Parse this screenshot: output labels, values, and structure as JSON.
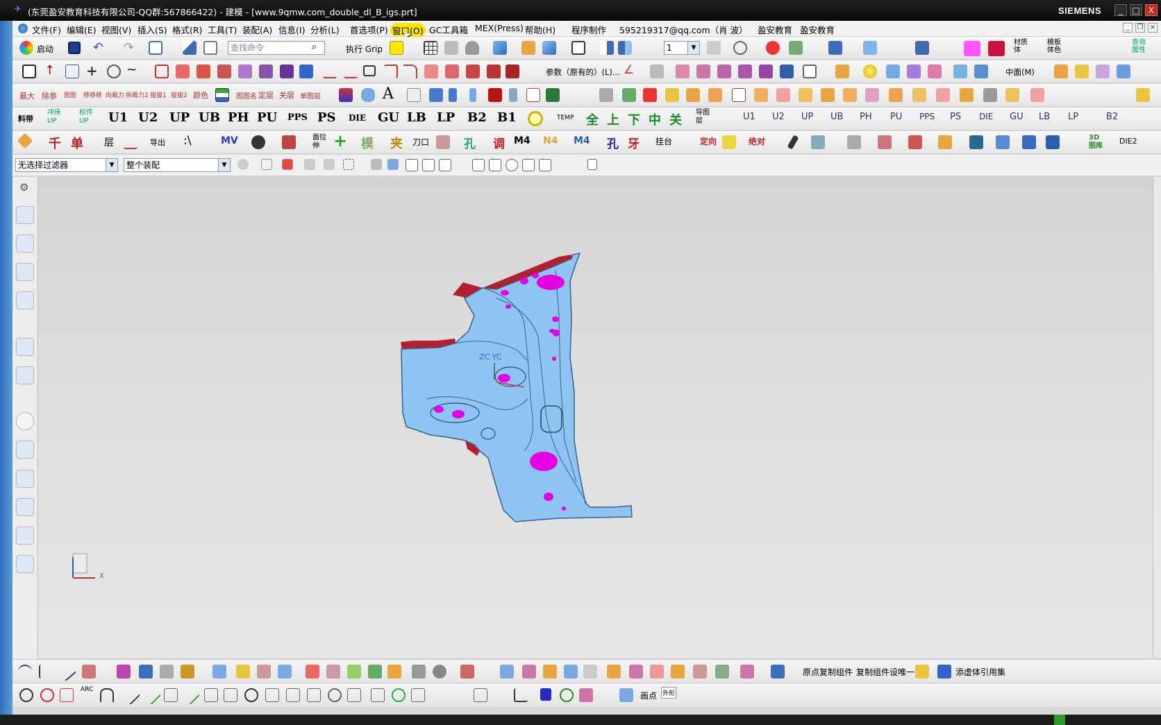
{
  "window": {
    "title": "(东莞盈安教育科技有限公司-QQ群:567866422) - 建模 - [www.9qmw.com_double_dl_B_igs.prt]",
    "brand": "SIEMENS",
    "buttons": [
      "_",
      "□",
      "X"
    ]
  },
  "menu": {
    "items": [
      "文件(F)",
      "编辑(E)",
      "视图(V)",
      "插入(S)",
      "格式(R)",
      "工具(T)",
      "装配(A)",
      "信息(I)",
      "分析(L)",
      "首选项(P)",
      "窗口(O)",
      "GC工具箱",
      "MEX(Press)",
      "帮助(H)",
      "程序制作",
      "595219317@qq.com（肖 波）",
      "盈安教育",
      "盈安教育"
    ],
    "active": "窗口(O)"
  },
  "toolbar1": {
    "start_label": "启动",
    "search_placeholder": "查找命令",
    "grip_label": "执行 Grip",
    "layer_value": "1",
    "material_label": "材质体",
    "template_label": "模板体色",
    "query_label": "查询属性"
  },
  "toolbar2": {
    "param_label": "参数（原有的）(L)...",
    "center_label": "中面(M)"
  },
  "toolbar3": {
    "labels": [
      "最大",
      "除参",
      "图图",
      "移移移",
      "向裁力",
      "拆裁力2",
      "拔拔1",
      "拔拔2",
      "颜色",
      "",
      "图图名",
      "定层",
      "关层",
      "单图层"
    ]
  },
  "toolbar4": {
    "labels": [
      "料带",
      "冲床UP",
      "标件UP",
      "U1",
      "U2",
      "UP",
      "UB",
      "PH",
      "PU",
      "PPS",
      "PS",
      "DIE",
      "GU",
      "LB",
      "LP",
      "B2",
      "B1",
      "TEMP",
      "全",
      "上",
      "下",
      "中",
      "关",
      "导图层"
    ],
    "right_labels": [
      "U1",
      "U2",
      "UP",
      "UB",
      "PH",
      "PU",
      "PPS",
      "PS",
      "DIE",
      "GU",
      "LB",
      "LP",
      "B2"
    ]
  },
  "toolbar5": {
    "labels": [
      "千",
      "单",
      "层",
      "导出",
      ":\\",
      "MV",
      "面拉伸",
      "模",
      "夹",
      "刀口",
      "孔",
      "调",
      "M4",
      "N4",
      "M4",
      "孔",
      "牙",
      "挂台",
      "定向",
      "绝对",
      "DIE2"
    ],
    "right_label": "3D图库"
  },
  "filterbar": {
    "filter_value": "无选择过滤器",
    "assembly_value": "整个装配"
  },
  "viewport": {
    "triad_label": "ZC YC",
    "axis_label": "X"
  },
  "bottom1": {
    "labels": [
      "原点复制组件",
      "复制组件设唯一",
      "添虚体引用集"
    ]
  },
  "bottom2": {
    "labels": [
      "ARC",
      "画点",
      "外形"
    ]
  },
  "colors": {
    "part_fill": "#8ec4f2",
    "holes": "#e600e6",
    "flange": "#b31f2e",
    "highlight": "#ffe600"
  }
}
